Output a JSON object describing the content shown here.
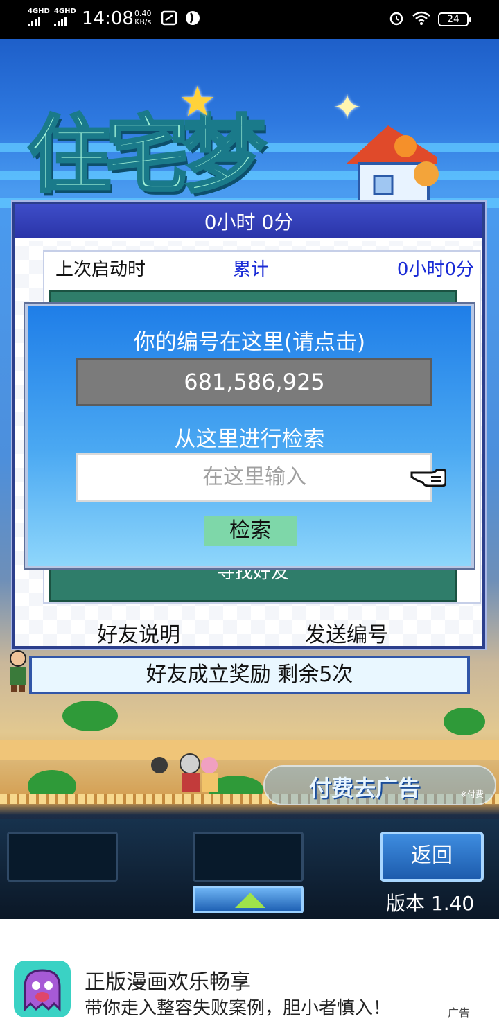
{
  "status_bar": {
    "signal_1": "4GHD",
    "signal_2": "4GHD",
    "time": "14:08",
    "speed_value": "0.40",
    "speed_unit": "KB/s",
    "battery": "24"
  },
  "game": {
    "logo_text": "住宅梦",
    "main_panel": {
      "header": "0小时 0分",
      "last_launch_label": "上次启动时",
      "total_label": "累计",
      "total_time": "0小时0分",
      "find_friend": "寻找好友",
      "friend_help": "好友说明",
      "send_id": "发送编号"
    },
    "dialog": {
      "title": "你的编号在这里(请点击)",
      "number": "681,586,925",
      "search_title": "从这里进行检索",
      "input_placeholder": "在这里输入",
      "search_button": "检索"
    },
    "reward": "好友成立奖励  剩余5次",
    "remove_ads": {
      "label": "付费去广告",
      "sub": "※付费"
    },
    "controls": {
      "back_button": "返回",
      "version": "版本 1.40"
    }
  },
  "ad": {
    "title": "正版漫画欢乐畅享",
    "description": "带你走入整容失败案例，胆小者慎入！",
    "tag": "广告"
  }
}
